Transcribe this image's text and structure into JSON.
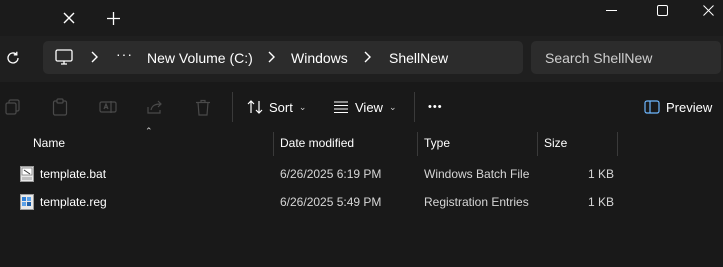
{
  "titlebar": {
    "close_tab": "✕",
    "new_tab": "+"
  },
  "address": {
    "overflow": "···",
    "crumbs": [
      "New Volume (C:)",
      "Windows",
      "ShellNew"
    ]
  },
  "search": {
    "placeholder": "Search ShellNew"
  },
  "toolbar": {
    "sort_label": "Sort",
    "view_label": "View",
    "more": "•••",
    "preview_label": "Preview"
  },
  "columns": {
    "name": "Name",
    "date": "Date modified",
    "type": "Type",
    "size": "Size"
  },
  "files": [
    {
      "name": "template.bat",
      "date": "6/26/2025 6:19 PM",
      "type": "Windows Batch File",
      "size": "1 KB",
      "icon": "batch-file-icon"
    },
    {
      "name": "template.reg",
      "date": "6/26/2025 5:49 PM",
      "type": "Registration Entries",
      "size": "1 KB",
      "icon": "registry-file-icon"
    }
  ]
}
